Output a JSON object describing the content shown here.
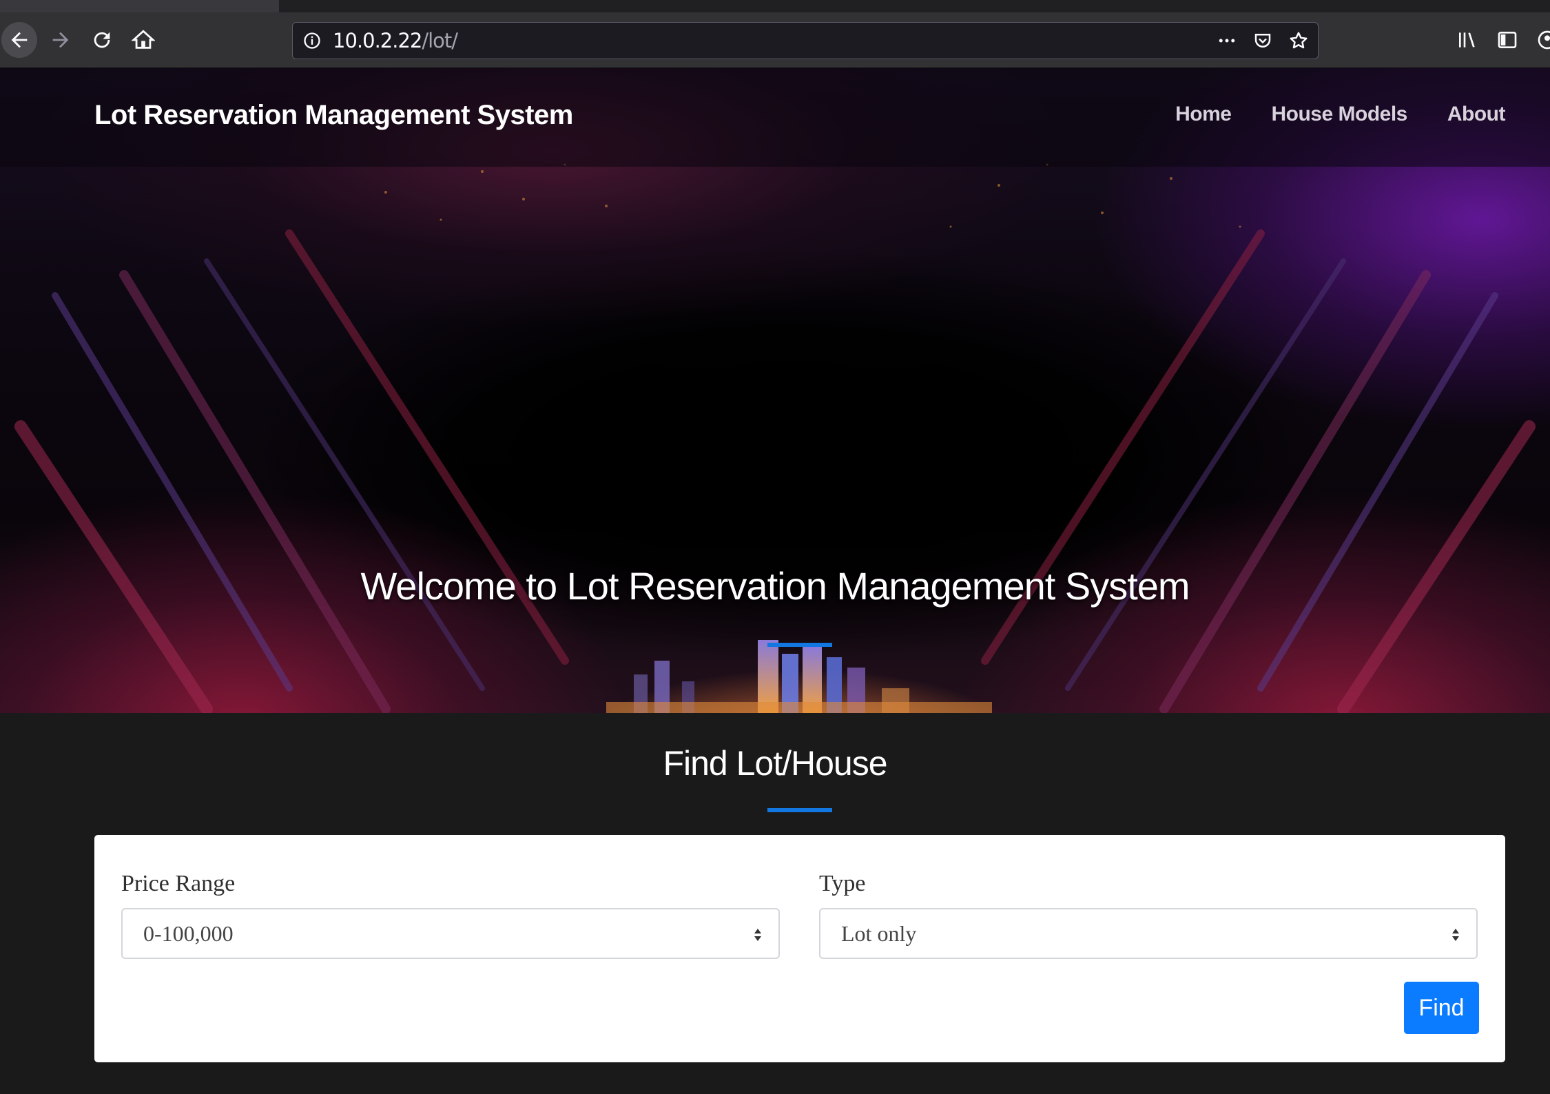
{
  "browser": {
    "url_host": "10.0.2.22",
    "url_path": "/lot/"
  },
  "navbar": {
    "brand": "Lot Reservation Management System",
    "links": [
      "Home",
      "House Models",
      "About"
    ]
  },
  "hero": {
    "title": "Welcome to Lot Reservation Management System"
  },
  "find": {
    "title": "Find Lot/House",
    "price_label": "Price Range",
    "price_value": "0-100,000",
    "type_label": "Type",
    "type_value": "Lot only",
    "button_label": "Find"
  },
  "colors": {
    "accent": "#1277e1",
    "button": "#0b7bff",
    "section_bg": "#1a1a1a"
  }
}
